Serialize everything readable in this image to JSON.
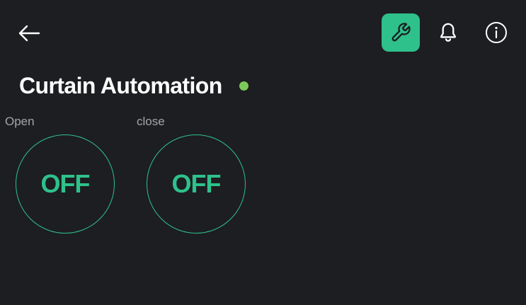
{
  "colors": {
    "background": "#1d1e21",
    "accent": "#2ec18c",
    "status_online": "#7ccb5a",
    "label": "#a3a5a8"
  },
  "header": {
    "back_icon": "arrow-left-icon",
    "tool_icon": "wrench-icon",
    "notifications_icon": "bell-icon",
    "info_icon": "info-icon"
  },
  "title": "Curtain Automation",
  "status": "online",
  "widgets": [
    {
      "label": "Open",
      "state": "OFF"
    },
    {
      "label": "close",
      "state": "OFF"
    }
  ]
}
